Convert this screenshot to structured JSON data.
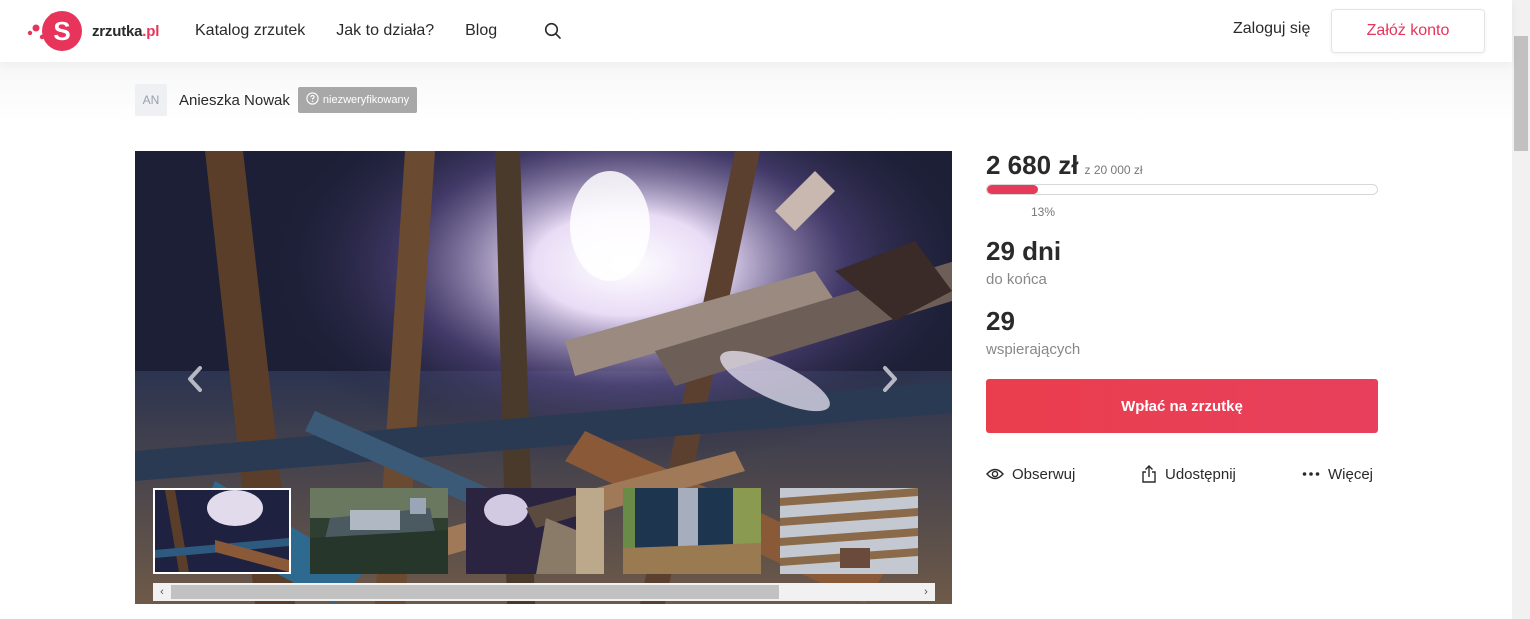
{
  "header": {
    "logo_text": "zrzutka",
    "logo_tld": ".pl",
    "nav": [
      "Katalog zrzutek",
      "Jak to działa?",
      "Blog"
    ],
    "login_label": "Zaloguj się",
    "register_label": "Załóż konto"
  },
  "author": {
    "initials": "AN",
    "name": "Anieszka Nowak",
    "badge": "niezweryfikowany"
  },
  "campaign": {
    "raised": "2 680 zł",
    "goal": "z 20 000 zł",
    "progress_percent": 13,
    "progress_label": "13%",
    "days_value": "29 dni",
    "days_label": "do końca",
    "supporters_value": "29",
    "supporters_label": "wspierających",
    "donate_label": "Wpłać na zrzutkę",
    "actions": {
      "watch": "Obserwuj",
      "share": "Udostępnij",
      "more": "Więcej"
    }
  },
  "gallery": {
    "thumbnail_count": 5,
    "active_thumbnail": 1
  },
  "colors": {
    "brand": "#e6345a",
    "cta": "#ea3e4d",
    "text": "#2a2a2a",
    "muted": "#888888",
    "badge": "#a8a8a8"
  },
  "icons": {
    "search": "search-icon",
    "watch": "eye-icon",
    "share": "share-icon",
    "more": "more-dots-icon",
    "prev": "chevron-left-icon",
    "next": "chevron-right-icon"
  }
}
